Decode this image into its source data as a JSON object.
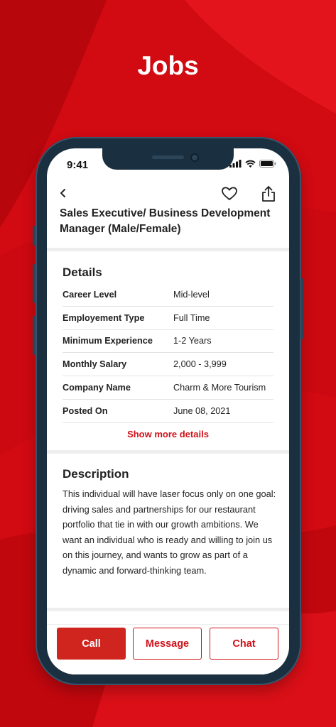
{
  "headline": "Jobs",
  "colors": {
    "brand_red": "#d0121a",
    "background_red": "#d20a12",
    "phone_frame": "#1a2f40"
  },
  "status_bar": {
    "time": "9:41",
    "icons": [
      "signal-icon",
      "wifi-icon",
      "battery-icon"
    ]
  },
  "nav": {
    "icons": [
      "back-chevron-icon",
      "heart-icon",
      "share-icon"
    ]
  },
  "job": {
    "title": "Sales Executive/ Business Development Manager (Male/Female)"
  },
  "details": {
    "title": "Details",
    "rows": [
      {
        "label": "Career Level",
        "value": "Mid-level"
      },
      {
        "label": "Employement Type",
        "value": "Full Time"
      },
      {
        "label": "Minimum Experience",
        "value": "1-2 Years"
      },
      {
        "label": "Monthly Salary",
        "value": "2,000 - 3,999"
      },
      {
        "label": "Company Name",
        "value": "Charm & More Tourism"
      },
      {
        "label": "Posted On",
        "value": "June 08, 2021"
      }
    ],
    "show_more": "Show more details"
  },
  "description": {
    "title": "Description",
    "text": "This individual will have laser focus only on one goal: driving sales and partnerships for our restaurant portfolio that tie in with our growth ambitions. We want an individual who is ready and willing to join us on this journey, and wants to grow as part of a dynamic and forward-thinking team."
  },
  "actions": {
    "call": "Call",
    "message": "Message",
    "chat": "Chat"
  }
}
